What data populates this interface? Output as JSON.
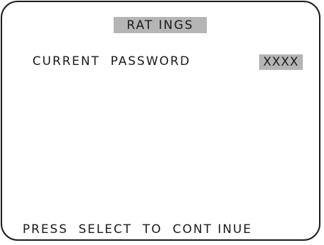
{
  "screen": {
    "title": "RAT INGS",
    "password_label": "CURRENT  PASSWORD",
    "password_value": "XXXX",
    "footer_prompt": "PRESS  SELECT  TO  CONT INUE"
  },
  "colors": {
    "highlight": "#b5b5b5",
    "text": "#1a1a1a",
    "background": "#ffffff"
  }
}
